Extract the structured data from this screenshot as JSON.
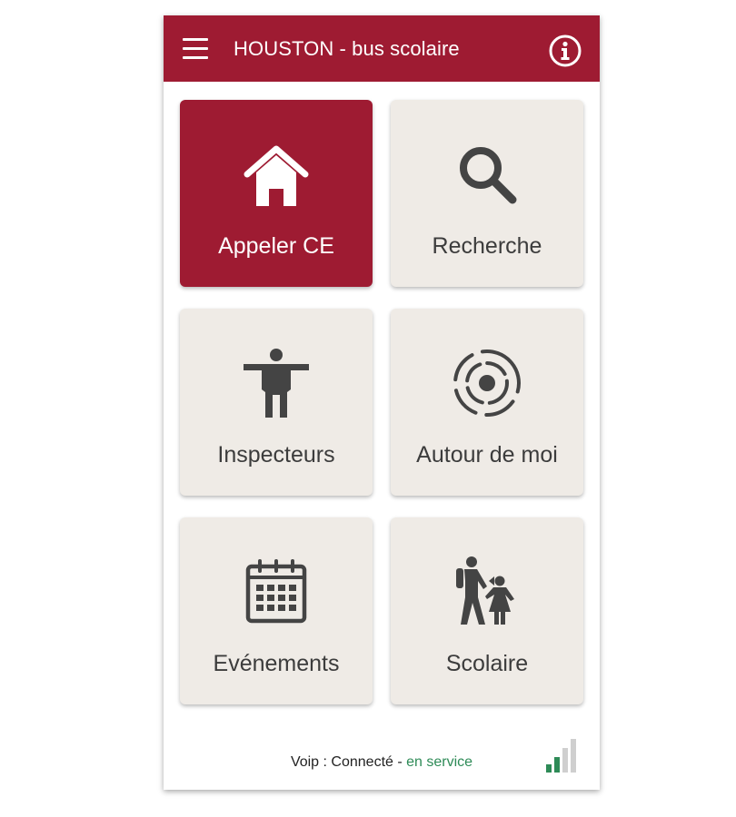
{
  "app": {
    "title": "HOUSTON - bus scolaire",
    "brand_color": "#9e1b32",
    "tile_color": "#efebe6",
    "menu_icon": "hamburger-menu-icon",
    "info_icon": "info-icon"
  },
  "tiles": [
    {
      "label": "Appeler CE",
      "icon": "home-icon",
      "active": true
    },
    {
      "label": "Recherche",
      "icon": "search-icon",
      "active": false
    },
    {
      "label": "Inspecteurs",
      "icon": "person-icon",
      "active": false
    },
    {
      "label": "Autour de moi",
      "icon": "location-radar-icon",
      "active": false
    },
    {
      "label": "Evénements",
      "icon": "calendar-icon",
      "active": false
    },
    {
      "label": "Scolaire",
      "icon": "school-children-icon",
      "active": false
    }
  ],
  "status": {
    "prefix": "Voip : Connecté - ",
    "state": "en service",
    "state_color": "#2e8b57",
    "signal_icon": "signal-strength-icon",
    "signal_level": 0.5
  }
}
